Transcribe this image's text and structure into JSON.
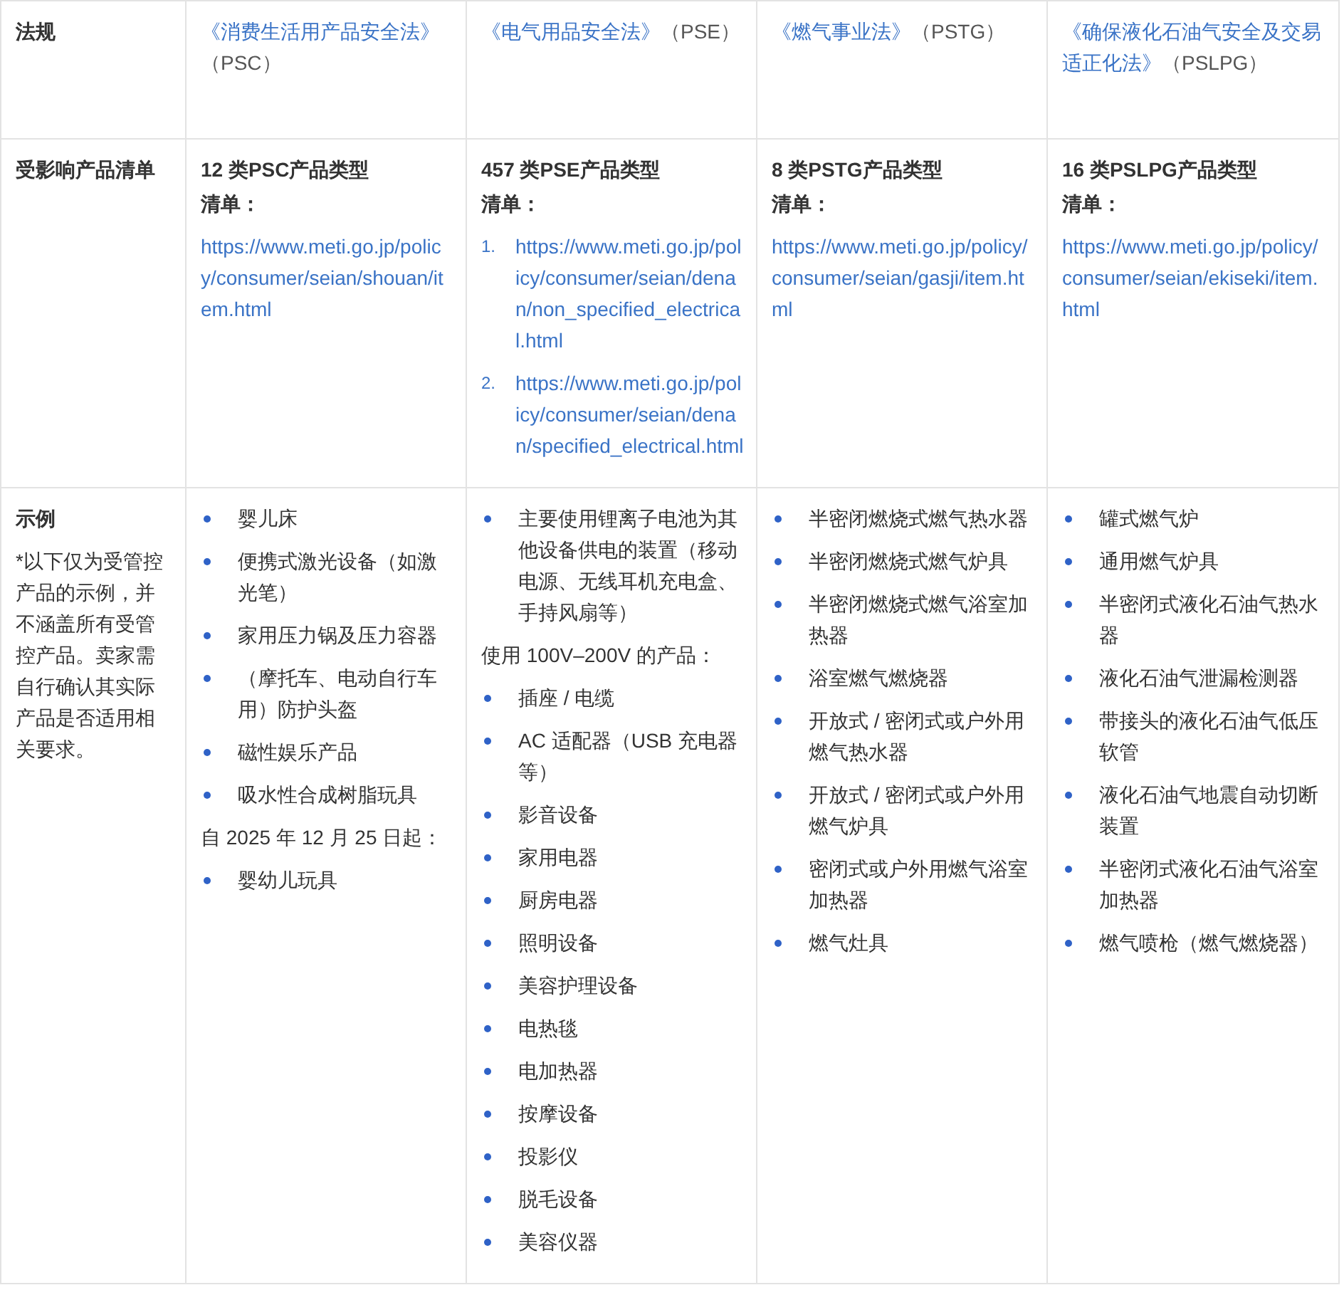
{
  "table": {
    "rows": [
      {
        "header": {
          "title": "法规"
        },
        "cells": [
          {
            "blocks": [
              {
                "kind": "law",
                "link": "《消费生活用产品安全法》",
                "text": "（PSC）"
              }
            ]
          },
          {
            "blocks": [
              {
                "kind": "law",
                "link": "《电气用品安全法》",
                "text": "（PSE）"
              }
            ]
          },
          {
            "blocks": [
              {
                "kind": "law",
                "link": "《燃气事业法》",
                "text": "（PSTG）"
              }
            ]
          },
          {
            "blocks": [
              {
                "kind": "law",
                "link": "《确保液化石油气安全及交易适正化法》",
                "text": "（PSLPG）"
              }
            ]
          }
        ]
      },
      {
        "header": {
          "title": "受影响产品清单"
        },
        "cells": [
          {
            "blocks": [
              {
                "kind": "heading",
                "text": "12 类PSC产品类型"
              },
              {
                "kind": "label",
                "text": "清单："
              },
              {
                "kind": "link",
                "text": "https://www.meti.go.jp/policy/consumer/seian/shouan/item.html"
              }
            ]
          },
          {
            "blocks": [
              {
                "kind": "heading",
                "text": "457 类PSE产品类型"
              },
              {
                "kind": "label",
                "text": "清单："
              },
              {
                "kind": "numbered",
                "items": [
                  {
                    "number": "1.",
                    "text": "https://www.meti.go.jp/policy/consumer/seian/denan/non_specified_electrical.html"
                  },
                  {
                    "number": "2.",
                    "text": "https://www.meti.go.jp/policy/consumer/seian/denan/specified_electrical.html"
                  }
                ]
              }
            ]
          },
          {
            "blocks": [
              {
                "kind": "heading",
                "text": "8 类PSTG产品类型"
              },
              {
                "kind": "label",
                "text": "清单："
              },
              {
                "kind": "link",
                "text": "https://www.meti.go.jp/policy/consumer/seian/gasji/item.html"
              }
            ]
          },
          {
            "blocks": [
              {
                "kind": "heading",
                "text": "16 类PSLPG产品类型"
              },
              {
                "kind": "label",
                "text": "清单："
              },
              {
                "kind": "link",
                "text": "https://www.meti.go.jp/policy/consumer/seian/ekiseki/item.html"
              }
            ]
          }
        ]
      },
      {
        "header": {
          "title": "示例",
          "note": "*以下仅为受管控产品的示例，并不涵盖所有受管控产品。卖家需自行确认其实际产品是否适用相关要求。"
        },
        "cells": [
          {
            "blocks": [
              {
                "kind": "bullets",
                "items": [
                  "婴儿床",
                  "便携式激光设备（如激光笔）",
                  "家用压力锅及压力容器",
                  "（摩托车、电动自行车用）防护头盔",
                  "磁性娱乐产品",
                  "吸水性合成树脂玩具"
                ]
              },
              {
                "kind": "label",
                "text": "自 2025 年 12 月 25 日起："
              },
              {
                "kind": "bullets",
                "items": [
                  "婴幼儿玩具"
                ]
              }
            ]
          },
          {
            "blocks": [
              {
                "kind": "bullets",
                "items": [
                  "主要使用锂离子电池为其他设备供电的装置（移动电源、无线耳机充电盒、手持风扇等）"
                ]
              },
              {
                "kind": "label",
                "text": "使用 100V–200V 的产品："
              },
              {
                "kind": "bullets",
                "items": [
                  "插座 / 电缆",
                  "AC 适配器（USB 充电器等）",
                  "影音设备",
                  "家用电器",
                  "厨房电器",
                  "照明设备",
                  "美容护理设备",
                  "电热毯",
                  "电加热器",
                  "按摩设备",
                  "投影仪",
                  "脱毛设备",
                  "美容仪器"
                ]
              }
            ]
          },
          {
            "blocks": [
              {
                "kind": "bullets",
                "items": [
                  "半密闭燃烧式燃气热水器",
                  "半密闭燃烧式燃气炉具",
                  "半密闭燃烧式燃气浴室加热器",
                  "浴室燃气燃烧器",
                  "开放式 / 密闭式或户外用燃气热水器",
                  "开放式 / 密闭式或户外用燃气炉具",
                  "密闭式或户外用燃气浴室加热器",
                  "燃气灶具"
                ]
              }
            ]
          },
          {
            "blocks": [
              {
                "kind": "bullets",
                "items": [
                  "罐式燃气炉",
                  "通用燃气炉具",
                  "半密闭式液化石油气热水器",
                  "液化石油气泄漏检测器",
                  "带接头的液化石油气低压软管",
                  "液化石油气地震自动切断装置",
                  "半密闭式液化石油气浴室加热器",
                  "燃气喷枪（燃气燃烧器）"
                ]
              }
            ]
          }
        ]
      }
    ]
  }
}
